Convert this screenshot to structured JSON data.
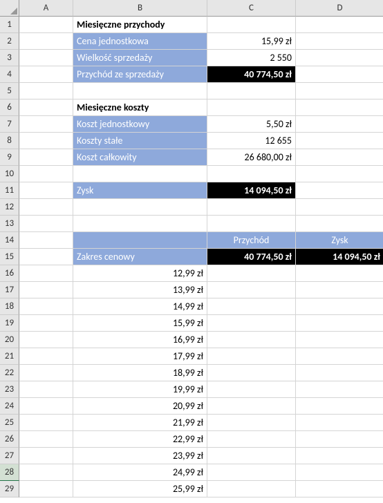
{
  "columns": [
    "A",
    "B",
    "C",
    "D"
  ],
  "rows": [
    "1",
    "2",
    "3",
    "4",
    "5",
    "6",
    "7",
    "8",
    "9",
    "10",
    "11",
    "12",
    "13",
    "14",
    "15",
    "16",
    "17",
    "18",
    "19",
    "20",
    "21",
    "22",
    "23",
    "24",
    "25",
    "26",
    "27",
    "28",
    "29"
  ],
  "selected_row": "28",
  "section1": {
    "title": "Miesięczne przychody",
    "r1_label": "Cena jednostkowa",
    "r1_val": "15,99 zł",
    "r2_label": "Wielkość sprzedaży",
    "r2_val": "2 550",
    "r3_label": "Przychód ze sprzedaży",
    "r3_val": "40 774,50 zł"
  },
  "section2": {
    "title": "Miesięczne koszty",
    "r1_label": "Koszt jednostkowy",
    "r1_val": "5,50 zł",
    "r2_label": "Koszty stałe",
    "r2_val": "12 655",
    "r3_label": "Koszt całkowity",
    "r3_val": "26 680,00 zł"
  },
  "zysk": {
    "label": "Zysk",
    "val": "14 094,50 zł"
  },
  "table2": {
    "head_c": "Przychód",
    "head_d": "Zysk",
    "range_label": "Zakres cenowy",
    "val_c": "40 774,50 zł",
    "val_d": "14 094,50 zł"
  },
  "prices": [
    "12,99 zł",
    "13,99 zł",
    "14,99 zł",
    "15,99 zł",
    "16,99 zł",
    "17,99 zł",
    "18,99 zł",
    "19,99 zł",
    "20,99 zł",
    "21,99 zł",
    "22,99 zł",
    "23,99 zł",
    "24,99 zł",
    "25,99 zł"
  ]
}
